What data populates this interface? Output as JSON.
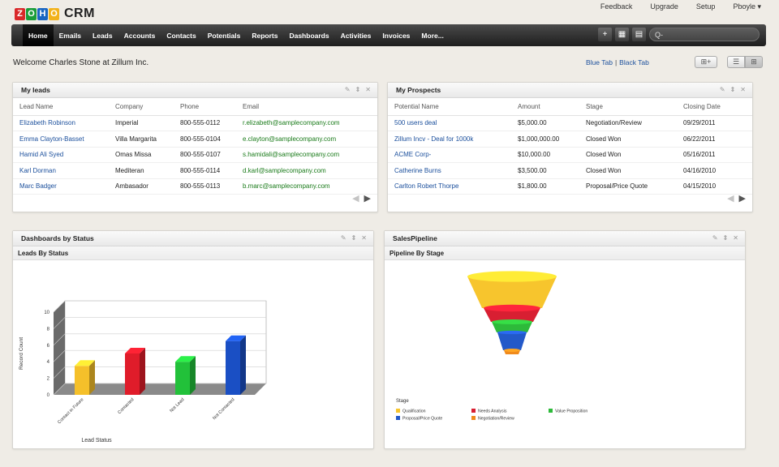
{
  "brand": {
    "logo_letters": [
      "Z",
      "O",
      "H",
      "O"
    ],
    "logo_colors": [
      "#d9282a",
      "#1a9d3a",
      "#1a66c2",
      "#f2b21b"
    ],
    "product": "CRM"
  },
  "toplinks": [
    "Feedback",
    "Upgrade",
    "Setup",
    "Pboyle ▾"
  ],
  "nav": {
    "tabs": [
      "Home",
      "Emails",
      "Leads",
      "Accounts",
      "Contacts",
      "Potentials",
      "Reports",
      "Dashboards",
      "Activities",
      "Invoices",
      "More..."
    ],
    "active_tab": "Home",
    "tools": [
      "+",
      "▦",
      "▤"
    ],
    "search_icon": "Q-"
  },
  "welcome": "Welcome Charles Stone at Zillum Inc.",
  "tab_links": {
    "blue": "Blue Tab",
    "sep": "|",
    "black": "Black Tab"
  },
  "layout_icons": {
    "add_widget": "⊞+",
    "list_view": "☰",
    "grid_view": "⊞"
  },
  "panel_controls": [
    "✎",
    "⇕",
    "✕"
  ],
  "my_leads": {
    "title": "My leads",
    "columns": [
      "Lead Name",
      "Company",
      "Phone",
      "Email"
    ],
    "rows": [
      [
        "Elizabeth Robinson",
        "Imperial",
        "800-555-0112",
        "r.elizabeth@samplecompany.com"
      ],
      [
        "Emma Clayton-Basset",
        "Villa Margarita",
        "800-555-0104",
        "e.clayton@samplecompany.com"
      ],
      [
        "Hamid Ali Syed",
        "Omas Missa",
        "800-555-0107",
        "s.hamidali@samplecompany.com"
      ],
      [
        "Karl Dorman",
        "Mediteran",
        "800-555-0114",
        "d.karl@samplecompany.com"
      ],
      [
        "Marc Badger",
        "Ambasador",
        "800-555-0113",
        "b.marc@samplecompany.com"
      ]
    ]
  },
  "my_prospects": {
    "title": "My Prospects",
    "columns": [
      "Potential Name",
      "Amount",
      "Stage",
      "Closing Date"
    ],
    "rows": [
      [
        "500 users deal",
        "$5,000.00",
        "Negotiation/Review",
        "09/29/2011"
      ],
      [
        "Zillum Incv - Deal for 1000k",
        "$1,000,000.00",
        "Closed Won",
        "06/22/2011"
      ],
      [
        "ACME Corp-",
        "$10,000.00",
        "Closed Won",
        "05/16/2011"
      ],
      [
        "Catherine Burns",
        "$3,500.00",
        "Closed Won",
        "04/16/2010"
      ],
      [
        "Carlton Robert Thorpe",
        "$1,800.00",
        "Proposal/Price Quote",
        "04/15/2010"
      ]
    ]
  },
  "pager": {
    "prev": "◀",
    "next": "▶"
  },
  "dashboards_panel": {
    "title": "Dashboards by Status",
    "subtitle": "Leads By Status"
  },
  "sales_pipeline_panel": {
    "title": "SalesPipeline",
    "subtitle": "Pipeline By Stage"
  },
  "chart_data": [
    {
      "type": "bar",
      "title": "Leads By Status",
      "xlabel": "Lead Status",
      "ylabel": "Record Count",
      "categories": [
        "Contact in Future",
        "Contacted",
        "Not Lead",
        "Not Contacted"
      ],
      "values": [
        3.5,
        5,
        4,
        6.5
      ],
      "colors": [
        "#f5c02a",
        "#e01c2a",
        "#22c13a",
        "#1a4fc4"
      ],
      "ylim": [
        0,
        10
      ],
      "yticks": [
        "0",
        "2",
        "4",
        "6",
        "8",
        "10"
      ],
      "grid": true,
      "style": "3d"
    },
    {
      "type": "funnel",
      "title": "Pipeline By Stage",
      "legend_title": "Stage",
      "stages": [
        {
          "name": "Qualification",
          "color": "#f7c52d"
        },
        {
          "name": "Needs Analysis",
          "color": "#d81f32"
        },
        {
          "name": "Value Proposition",
          "color": "#2dba3a"
        },
        {
          "name": "Proposal/Price Quote",
          "color": "#2359c9"
        },
        {
          "name": "Negotiation/Review",
          "color": "#f08a1c"
        }
      ],
      "legend_placement": "bottom-left"
    }
  ]
}
